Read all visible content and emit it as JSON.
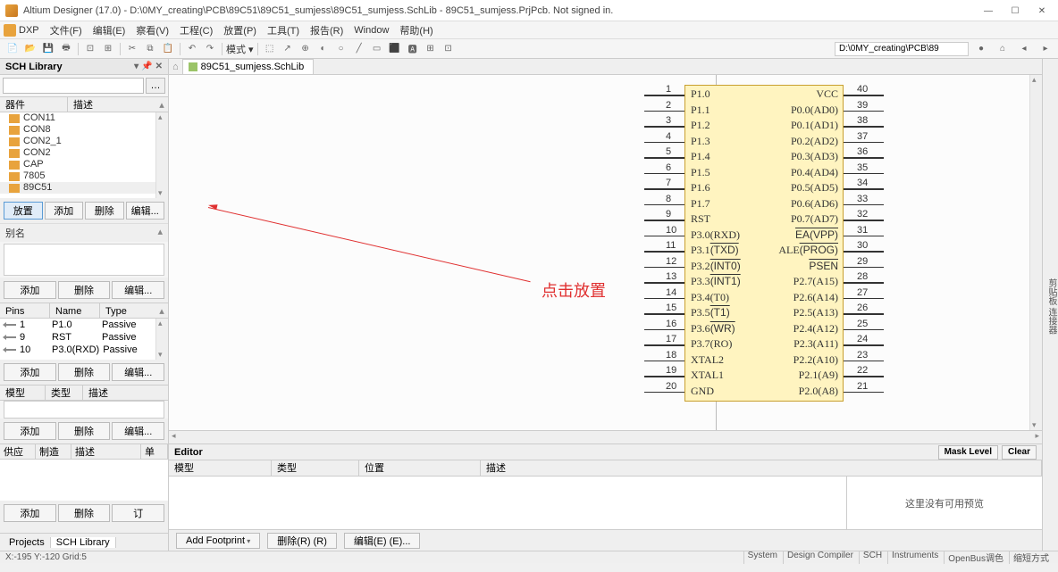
{
  "title": "Altium Designer (17.0) - D:\\0MY_creating\\PCB\\89C51\\89C51_sumjess\\89C51_sumjess.SchLib - 89C51_sumjess.PrjPcb. Not signed in.",
  "menu": {
    "dxp": "DXP",
    "file": "文件(F)",
    "edit": "编辑(E)",
    "view": "察看(V)",
    "project": "工程(C)",
    "place": "放置(P)",
    "tools": "工具(T)",
    "reports": "报告(R)",
    "window": "Window",
    "help": "帮助(H)"
  },
  "toolbar_path": "D:\\0MY_creating\\PCB\\89",
  "toolbar_mode": "模式 ▾",
  "sch_library": {
    "title": "SCH Library",
    "comp_col": "器件",
    "desc_col": "描述",
    "items": [
      "CON11",
      "CON8",
      "CON2_1",
      "CON2",
      "CAP",
      "7805",
      "89C51"
    ],
    "btn_place": "放置",
    "btn_add": "添加",
    "btn_del": "删除",
    "btn_edit": "编辑...",
    "alias": "别名",
    "pins": "Pins",
    "name": "Name",
    "type": "Type",
    "pin_rows": [
      {
        "n": "1",
        "name": "P1.0",
        "type": "Passive"
      },
      {
        "n": "9",
        "name": "RST",
        "type": "Passive"
      },
      {
        "n": "10",
        "name": "P3.0(RXD)",
        "type": "Passive"
      }
    ],
    "model": "模型",
    "mtype": "类型",
    "mdesc": "描述",
    "supplier": "供应商",
    "mfr": "制造商",
    "sdesc": "描述",
    "price": "单价",
    "order": "订"
  },
  "tabs": {
    "projects": "Projects",
    "schlib": "SCH Library"
  },
  "doctab": "89C51_sumjess.SchLib",
  "annotation": "点击放置",
  "rightbar": "剪贴板  连接器",
  "chip": {
    "left_pins": [
      {
        "n": "1",
        "label": "P1.0"
      },
      {
        "n": "2",
        "label": "P1.1"
      },
      {
        "n": "3",
        "label": "P1.2"
      },
      {
        "n": "4",
        "label": "P1.3"
      },
      {
        "n": "5",
        "label": "P1.4"
      },
      {
        "n": "6",
        "label": "P1.5"
      },
      {
        "n": "7",
        "label": "P1.6"
      },
      {
        "n": "8",
        "label": "P1.7"
      },
      {
        "n": "9",
        "label": "RST"
      },
      {
        "n": "10",
        "label": "P3.0(RXD)"
      },
      {
        "n": "11",
        "label": "P3.1"
      },
      {
        "n": "12",
        "label": "P3.2"
      },
      {
        "n": "13",
        "label": "P3.3"
      },
      {
        "n": "14",
        "label": "P3.4(T0)"
      },
      {
        "n": "15",
        "label": "P3.5"
      },
      {
        "n": "16",
        "label": "P3.6"
      },
      {
        "n": "17",
        "label": "P3.7(RO)"
      },
      {
        "n": "18",
        "label": "XTAL2"
      },
      {
        "n": "19",
        "label": "XTAL1"
      },
      {
        "n": "20",
        "label": "GND"
      }
    ],
    "left_extra": {
      "10": "",
      "11": "(TXD)",
      "12": "(INT0)",
      "13": "(INT1)",
      "15": "(T1)",
      "16": "(WR)"
    },
    "right_pins": [
      {
        "n": "40",
        "label": "VCC"
      },
      {
        "n": "39",
        "label": "P0.0(AD0)"
      },
      {
        "n": "38",
        "label": "P0.1(AD1)"
      },
      {
        "n": "37",
        "label": "P0.2(AD2)"
      },
      {
        "n": "36",
        "label": "P0.3(AD3)"
      },
      {
        "n": "35",
        "label": "P0.4(AD4)"
      },
      {
        "n": "34",
        "label": "P0.5(AD5)"
      },
      {
        "n": "33",
        "label": "P0.6(AD6)"
      },
      {
        "n": "32",
        "label": "P0.7(AD7)"
      },
      {
        "n": "31",
        "label": ""
      },
      {
        "n": "30",
        "label": "ALE"
      },
      {
        "n": "29",
        "label": ""
      },
      {
        "n": "28",
        "label": "P2.7(A15)"
      },
      {
        "n": "27",
        "label": "P2.6(A14)"
      },
      {
        "n": "26",
        "label": "P2.5(A13)"
      },
      {
        "n": "25",
        "label": "P2.4(A12)"
      },
      {
        "n": "24",
        "label": "P2.3(A11)"
      },
      {
        "n": "23",
        "label": "P2.2(A10)"
      },
      {
        "n": "22",
        "label": "P2.1(A9)"
      },
      {
        "n": "21",
        "label": "P2.0(A8)"
      }
    ],
    "right_ov": {
      "31": "EA(VPP)",
      "30": "(PROG)",
      "29": "PSEN"
    }
  },
  "editor_panel": {
    "title": "Editor",
    "mask": "Mask Level",
    "clear": "Clear",
    "col_model": "模型",
    "col_type": "类型",
    "col_loc": "位置",
    "col_desc": "描述",
    "nopreview": "这里没有可用预览",
    "add_fp": "Add Footprint",
    "del": "删除(R) (R)",
    "edit": "编辑(E) (E)..."
  },
  "status": {
    "left": "X:-195 Y:-120   Grid:5",
    "tabs": [
      "System",
      "Design Compiler",
      "SCH",
      "Instruments",
      "OpenBus调色",
      "缩短方式"
    ]
  }
}
